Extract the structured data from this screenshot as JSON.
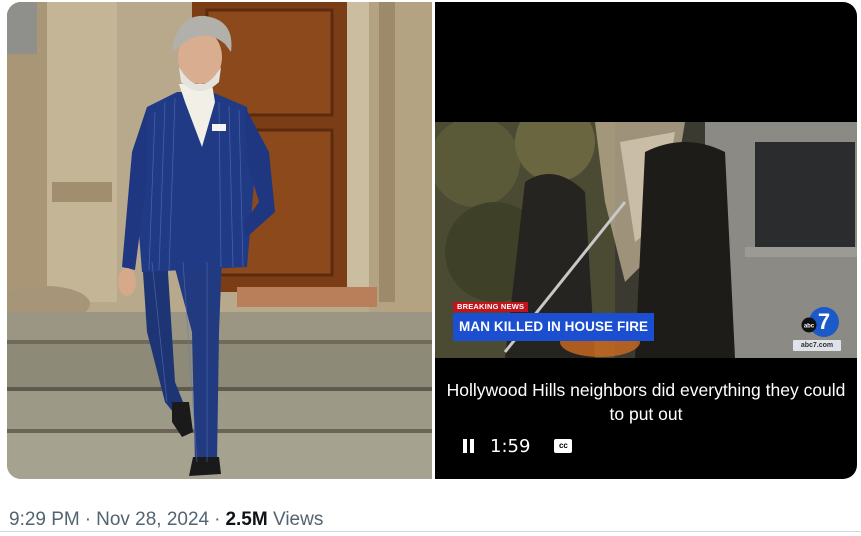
{
  "video": {
    "breaking_tag": "BREAKING NEWS",
    "headline": "MAN KILLED IN HOUSE FIRE",
    "station_logo_text": "abc",
    "station_number": "7",
    "station_url": "abc7.com",
    "caption": "Hollywood Hills neighbors did everything they could to put out",
    "time_remaining": "1:59",
    "cc_label": "cc"
  },
  "meta": {
    "time": "9:29 PM",
    "separator": "·",
    "date": "Nov 28, 2024",
    "views_count": "2.5M",
    "views_label": "Views"
  }
}
